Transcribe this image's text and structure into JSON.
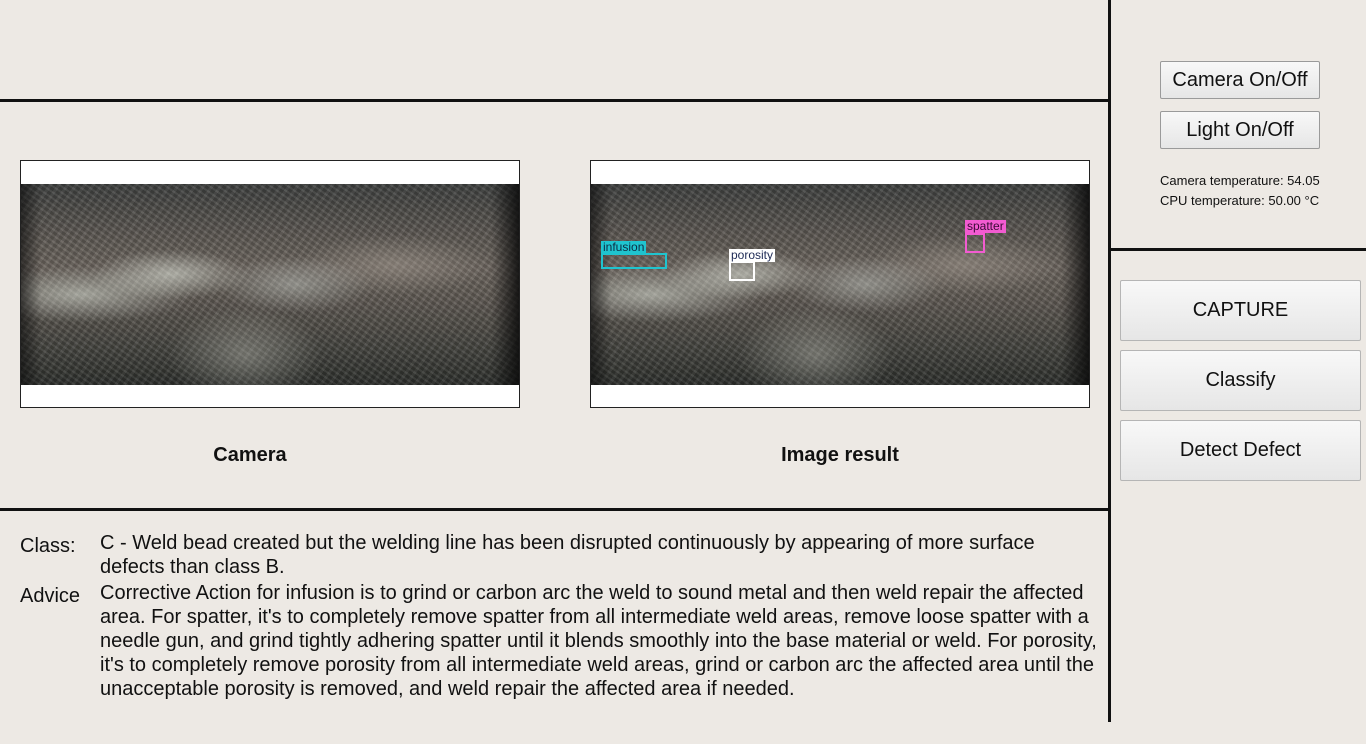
{
  "controls": {
    "camera_button": "Camera On/Off",
    "light_button": "Light On/Off",
    "camera_temperature": "Camera temperature: 54.05",
    "cpu_temperature": "CPU temperature: 50.00 °C"
  },
  "actions": {
    "capture": "CAPTURE",
    "classify": "Classify",
    "detect_defect": "Detect Defect"
  },
  "panels": {
    "camera_label": "Camera",
    "result_label": "Image result"
  },
  "detections": [
    {
      "label": "infusion",
      "color": "#1fc4cf"
    },
    {
      "label": "porosity",
      "color": "#ffffff"
    },
    {
      "label": "spatter",
      "color": "#f25bd1"
    }
  ],
  "result": {
    "class_label": "Class:",
    "class_text": "C - Weld bead created but the welding line has been disrupted continuously by appearing of more surface defects than class B.",
    "advice_label": "Advice",
    "advice_text": "Corrective Action for infusion is to grind or carbon arc the weld to sound metal and then weld repair the affected area. For spatter, it's to completely remove spatter from all intermediate weld areas, remove loose spatter with a needle gun, and grind tightly adhering spatter until it blends smoothly into the base material or weld. For porosity, it's to completely remove porosity from all intermediate weld areas, grind or carbon arc the affected area until the unacceptable porosity is removed, and weld repair the affected area if needed."
  }
}
